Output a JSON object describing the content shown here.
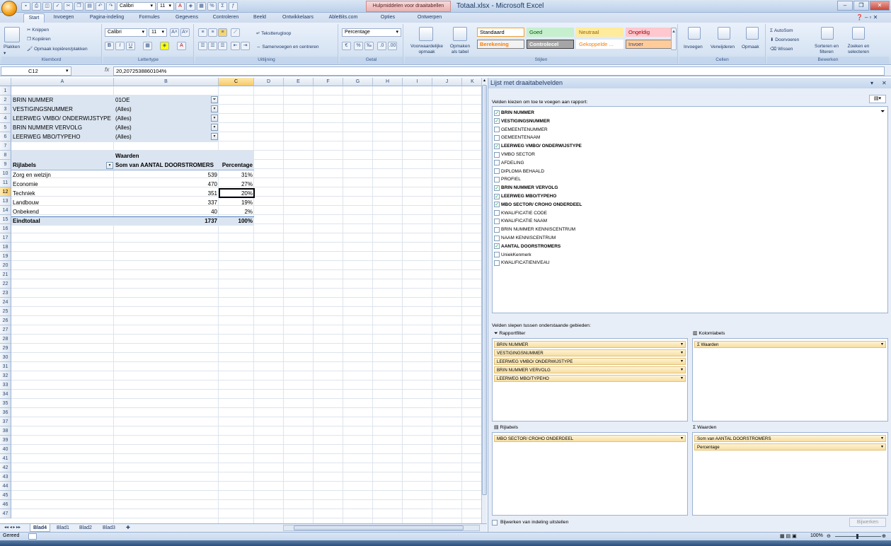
{
  "window": {
    "title": "Totaal.xlsx - Microsoft Excel",
    "context_tab": "Hulpmiddelen voor draaitabellen"
  },
  "qat": {
    "font": "Calibri",
    "size": "11"
  },
  "tabs": [
    "Start",
    "Invoegen",
    "Pagina-indeling",
    "Formules",
    "Gegevens",
    "Controleren",
    "Beeld",
    "Ontwikkelaars",
    "AbleBits.com",
    "Opties",
    "Ontwerpen"
  ],
  "ribbon": {
    "clipboard": {
      "paste": "Plakken",
      "cut": "Knippen",
      "copy": "Kopiëren",
      "format_painter": "Opmaak kopiëren/plakken",
      "label": "Klembord"
    },
    "font": {
      "name": "Calibri",
      "size": "11",
      "label": "Lettertype"
    },
    "alignment": {
      "wrap": "Tekstterugloop",
      "merge": "Samenvoegen en centreren",
      "label": "Uitlijning"
    },
    "number": {
      "format": "Percentage",
      "label": "Getal"
    },
    "styles": {
      "conditional": "Voorwaardelijke opmaak",
      "as_table": "Opmaken als tabel",
      "label": "Stijlen",
      "cells": [
        {
          "label": "Standaard",
          "bg": "#ffffff",
          "fg": "#000000",
          "border": "#f0a030"
        },
        {
          "label": "Goed",
          "bg": "#c6efce",
          "fg": "#006100",
          "border": "#c6efce"
        },
        {
          "label": "Neutraal",
          "bg": "#ffeb9c",
          "fg": "#9c6500",
          "border": "#ffeb9c"
        },
        {
          "label": "Ongeldig",
          "bg": "#ffc7ce",
          "fg": "#9c0006",
          "border": "#ffc7ce"
        },
        {
          "label": "Berekening",
          "bg": "#f2f2f2",
          "fg": "#fa7d00",
          "border": "#7f7f7f"
        },
        {
          "label": "Controlecel",
          "bg": "#a5a5a5",
          "fg": "#ffffff",
          "border": "#3f3f3f"
        },
        {
          "label": "Gekoppelde ...",
          "bg": "#ffffff",
          "fg": "#fa7d00",
          "border": "#ffffff"
        },
        {
          "label": "Invoer",
          "bg": "#ffcc99",
          "fg": "#3f3f76",
          "border": "#7f7f7f"
        }
      ]
    },
    "cells": {
      "insert": "Invoegen",
      "delete": "Verwijderen",
      "format": "Opmaak",
      "label": "Cellen"
    },
    "editing": {
      "autosum": "AutoSom",
      "fill": "Doorvoeren",
      "clear": "Wissen",
      "sort": "Sorteren en filteren",
      "find": "Zoeken en selecteren",
      "label": "Bewerken"
    }
  },
  "formula_bar": {
    "name_box": "C12",
    "fx": "fx",
    "formula": "20,2072538860104%"
  },
  "columns": [
    "A",
    "B",
    "C",
    "D",
    "E",
    "F",
    "G",
    "H",
    "I",
    "J",
    "K"
  ],
  "rows": [
    "1",
    "2",
    "3",
    "4",
    "5",
    "6",
    "7",
    "8",
    "9",
    "10",
    "11",
    "12",
    "13",
    "14",
    "15",
    "16",
    "17",
    "18",
    "19",
    "20",
    "21",
    "22",
    "23",
    "24",
    "25",
    "26",
    "27",
    "28",
    "29",
    "30",
    "31",
    "32",
    "33",
    "34",
    "35",
    "36",
    "37",
    "38",
    "39",
    "40",
    "41",
    "42",
    "43",
    "44",
    "45",
    "46",
    "47"
  ],
  "filters": [
    {
      "field": "BRIN NUMMER",
      "value": "01OE"
    },
    {
      "field": "VESTIGINGSNUMMER",
      "value": "(Alles)"
    },
    {
      "field": "LEERWEG VMBO/ ONDERWIJSTYPE",
      "value": "(Alles)"
    },
    {
      "field": "BRIN NUMMER VERVOLG",
      "value": "(Alles)"
    },
    {
      "field": "LEERWEG MBO/TYPEHO",
      "value": "(Alles)"
    }
  ],
  "pivot": {
    "values_caption": "Waarden",
    "row_labels": "Rijlabels",
    "col1": "Som van AANTAL DOORSTROMERS",
    "col2": "Percentage",
    "rows": [
      {
        "label": "Zorg en welzijn",
        "count": "539",
        "pct": "31%"
      },
      {
        "label": "Economie",
        "count": "470",
        "pct": "27%"
      },
      {
        "label": "Techniek",
        "count": "351",
        "pct": "20%"
      },
      {
        "label": "Landbouw",
        "count": "337",
        "pct": "19%"
      },
      {
        "label": "Onbekend",
        "count": "40",
        "pct": "2%"
      }
    ],
    "total": {
      "label": "Eindtotaal",
      "count": "1737",
      "pct": "100%"
    }
  },
  "sheets": [
    "Blad4",
    "Blad1",
    "Blad2",
    "Blad3"
  ],
  "status": {
    "ready": "Gereed",
    "zoom": "100%"
  },
  "panel": {
    "title": "Lijst met draaitabelvelden",
    "choose": "Velden kiezen om toe te voegen aan rapport:",
    "drag": "Velden slepen tussen onderstaande gebieden:",
    "fields": [
      {
        "name": "BRIN NUMMER",
        "checked": true
      },
      {
        "name": "VESTIGINGSNUMMER",
        "checked": true
      },
      {
        "name": "GEMEENTENUMMER",
        "checked": false
      },
      {
        "name": "GEMEENTENAAM",
        "checked": false
      },
      {
        "name": "LEERWEG VMBO/ ONDERWIJSTYPE",
        "checked": true
      },
      {
        "name": "VMBO SECTOR",
        "checked": false
      },
      {
        "name": "AFDELING",
        "checked": false
      },
      {
        "name": "DIPLOMA BEHAALD",
        "checked": false
      },
      {
        "name": "PROFIEL",
        "checked": false
      },
      {
        "name": "BRIN NUMMER VERVOLG",
        "checked": true
      },
      {
        "name": "LEERWEG MBO/TYPEHO",
        "checked": true
      },
      {
        "name": "MBO SECTOR/ CROHO ONDERDEEL",
        "checked": true
      },
      {
        "name": "KWALIFICATIE CODE",
        "checked": false
      },
      {
        "name": "KWALIFICATIE NAAM",
        "checked": false
      },
      {
        "name": "BRIN NUMMER KENNISCENTRUM",
        "checked": false
      },
      {
        "name": "NAAM KENNISCENTRUM",
        "checked": false
      },
      {
        "name": "AANTAL DOORSTROMERS",
        "checked": true
      },
      {
        "name": "UniekKenmerk",
        "checked": false
      },
      {
        "name": "KWALIFICATIENIVEAU",
        "checked": false
      }
    ],
    "report_filter": {
      "label": "Rapportfilter",
      "items": [
        "BRIN NUMMER",
        "VESTIGINGSNUMMER",
        "LEERWEG VMBO/ ONDERWIJSTYPE",
        "BRIN NUMMER VERVOLG",
        "LEERWEG MBO/TYPEHO"
      ]
    },
    "column_labels": {
      "label": "Kolomlabels",
      "items": [
        "Waarden"
      ]
    },
    "row_labels": {
      "label": "Rijlabels",
      "items": [
        "MBO SECTOR/ CROHO ONDERDEEL"
      ]
    },
    "values": {
      "label": "Waarden",
      "items": [
        "Som van AANTAL DOORSTROMERS",
        "Percentage"
      ]
    },
    "defer": "Bijwerken van indeling uitstellen",
    "update": "Bijwerken"
  }
}
